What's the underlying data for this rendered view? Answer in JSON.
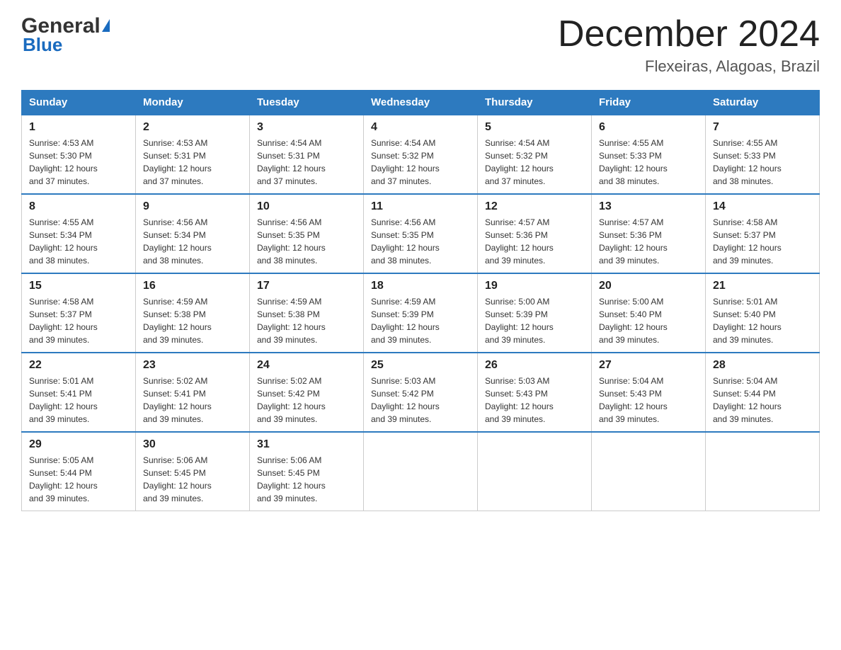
{
  "header": {
    "logo_general": "General",
    "logo_blue": "Blue",
    "main_title": "December 2024",
    "subtitle": "Flexeiras, Alagoas, Brazil"
  },
  "days_of_week": [
    "Sunday",
    "Monday",
    "Tuesday",
    "Wednesday",
    "Thursday",
    "Friday",
    "Saturday"
  ],
  "weeks": [
    [
      {
        "day": "1",
        "sunrise": "4:53 AM",
        "sunset": "5:30 PM",
        "daylight": "12 hours and 37 minutes."
      },
      {
        "day": "2",
        "sunrise": "4:53 AM",
        "sunset": "5:31 PM",
        "daylight": "12 hours and 37 minutes."
      },
      {
        "day": "3",
        "sunrise": "4:54 AM",
        "sunset": "5:31 PM",
        "daylight": "12 hours and 37 minutes."
      },
      {
        "day": "4",
        "sunrise": "4:54 AM",
        "sunset": "5:32 PM",
        "daylight": "12 hours and 37 minutes."
      },
      {
        "day": "5",
        "sunrise": "4:54 AM",
        "sunset": "5:32 PM",
        "daylight": "12 hours and 37 minutes."
      },
      {
        "day": "6",
        "sunrise": "4:55 AM",
        "sunset": "5:33 PM",
        "daylight": "12 hours and 38 minutes."
      },
      {
        "day": "7",
        "sunrise": "4:55 AM",
        "sunset": "5:33 PM",
        "daylight": "12 hours and 38 minutes."
      }
    ],
    [
      {
        "day": "8",
        "sunrise": "4:55 AM",
        "sunset": "5:34 PM",
        "daylight": "12 hours and 38 minutes."
      },
      {
        "day": "9",
        "sunrise": "4:56 AM",
        "sunset": "5:34 PM",
        "daylight": "12 hours and 38 minutes."
      },
      {
        "day": "10",
        "sunrise": "4:56 AM",
        "sunset": "5:35 PM",
        "daylight": "12 hours and 38 minutes."
      },
      {
        "day": "11",
        "sunrise": "4:56 AM",
        "sunset": "5:35 PM",
        "daylight": "12 hours and 38 minutes."
      },
      {
        "day": "12",
        "sunrise": "4:57 AM",
        "sunset": "5:36 PM",
        "daylight": "12 hours and 39 minutes."
      },
      {
        "day": "13",
        "sunrise": "4:57 AM",
        "sunset": "5:36 PM",
        "daylight": "12 hours and 39 minutes."
      },
      {
        "day": "14",
        "sunrise": "4:58 AM",
        "sunset": "5:37 PM",
        "daylight": "12 hours and 39 minutes."
      }
    ],
    [
      {
        "day": "15",
        "sunrise": "4:58 AM",
        "sunset": "5:37 PM",
        "daylight": "12 hours and 39 minutes."
      },
      {
        "day": "16",
        "sunrise": "4:59 AM",
        "sunset": "5:38 PM",
        "daylight": "12 hours and 39 minutes."
      },
      {
        "day": "17",
        "sunrise": "4:59 AM",
        "sunset": "5:38 PM",
        "daylight": "12 hours and 39 minutes."
      },
      {
        "day": "18",
        "sunrise": "4:59 AM",
        "sunset": "5:39 PM",
        "daylight": "12 hours and 39 minutes."
      },
      {
        "day": "19",
        "sunrise": "5:00 AM",
        "sunset": "5:39 PM",
        "daylight": "12 hours and 39 minutes."
      },
      {
        "day": "20",
        "sunrise": "5:00 AM",
        "sunset": "5:40 PM",
        "daylight": "12 hours and 39 minutes."
      },
      {
        "day": "21",
        "sunrise": "5:01 AM",
        "sunset": "5:40 PM",
        "daylight": "12 hours and 39 minutes."
      }
    ],
    [
      {
        "day": "22",
        "sunrise": "5:01 AM",
        "sunset": "5:41 PM",
        "daylight": "12 hours and 39 minutes."
      },
      {
        "day": "23",
        "sunrise": "5:02 AM",
        "sunset": "5:41 PM",
        "daylight": "12 hours and 39 minutes."
      },
      {
        "day": "24",
        "sunrise": "5:02 AM",
        "sunset": "5:42 PM",
        "daylight": "12 hours and 39 minutes."
      },
      {
        "day": "25",
        "sunrise": "5:03 AM",
        "sunset": "5:42 PM",
        "daylight": "12 hours and 39 minutes."
      },
      {
        "day": "26",
        "sunrise": "5:03 AM",
        "sunset": "5:43 PM",
        "daylight": "12 hours and 39 minutes."
      },
      {
        "day": "27",
        "sunrise": "5:04 AM",
        "sunset": "5:43 PM",
        "daylight": "12 hours and 39 minutes."
      },
      {
        "day": "28",
        "sunrise": "5:04 AM",
        "sunset": "5:44 PM",
        "daylight": "12 hours and 39 minutes."
      }
    ],
    [
      {
        "day": "29",
        "sunrise": "5:05 AM",
        "sunset": "5:44 PM",
        "daylight": "12 hours and 39 minutes."
      },
      {
        "day": "30",
        "sunrise": "5:06 AM",
        "sunset": "5:45 PM",
        "daylight": "12 hours and 39 minutes."
      },
      {
        "day": "31",
        "sunrise": "5:06 AM",
        "sunset": "5:45 PM",
        "daylight": "12 hours and 39 minutes."
      },
      null,
      null,
      null,
      null
    ]
  ]
}
